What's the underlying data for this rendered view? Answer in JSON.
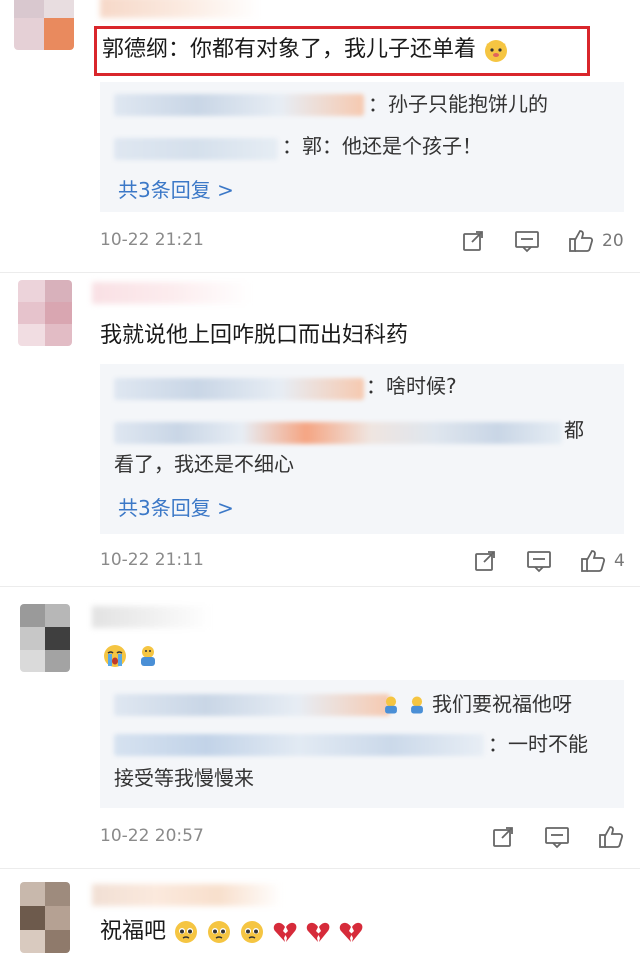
{
  "comments": [
    {
      "text": "郭德纲：你都有对象了，我儿子还单着",
      "emoji": "dog-face-emoji",
      "replies": [
        {
          "text": "：孙子只能抱饼儿的"
        },
        {
          "text": "：郭：他还是个孩子！"
        }
      ],
      "more_replies": "共3条回复 >",
      "timestamp": "10-22 21:21",
      "like_count": "20"
    },
    {
      "text": "我就说他上回咋脱口而出妇科药",
      "replies": [
        {
          "text": "：啥时候?"
        },
        {
          "text_tail": "都",
          "text_line2": "看了，我还是不细心"
        }
      ],
      "more_replies": "共3条回复 >",
      "timestamp": "10-22 21:11",
      "like_count": "4"
    },
    {
      "text": "",
      "emojis": [
        "loudly-crying-emoji",
        "hug-emoji"
      ],
      "replies": [
        {
          "text": "我们要祝福他呀"
        },
        {
          "text_tail": "：一时不能",
          "text_line2": "接受等我慢慢来"
        }
      ],
      "timestamp": "10-22 20:57",
      "like_count": ""
    },
    {
      "text": "祝福吧",
      "emojis": [
        "pleading-face-emoji",
        "pleading-face-emoji",
        "pleading-face-emoji",
        "broken-heart-emoji",
        "broken-heart-emoji",
        "broken-heart-emoji"
      ]
    }
  ],
  "colors": {
    "highlight": "#d9262b",
    "link": "#3b78c7",
    "reply_bg": "#f4f6f9",
    "meta": "#8a8a8a"
  }
}
